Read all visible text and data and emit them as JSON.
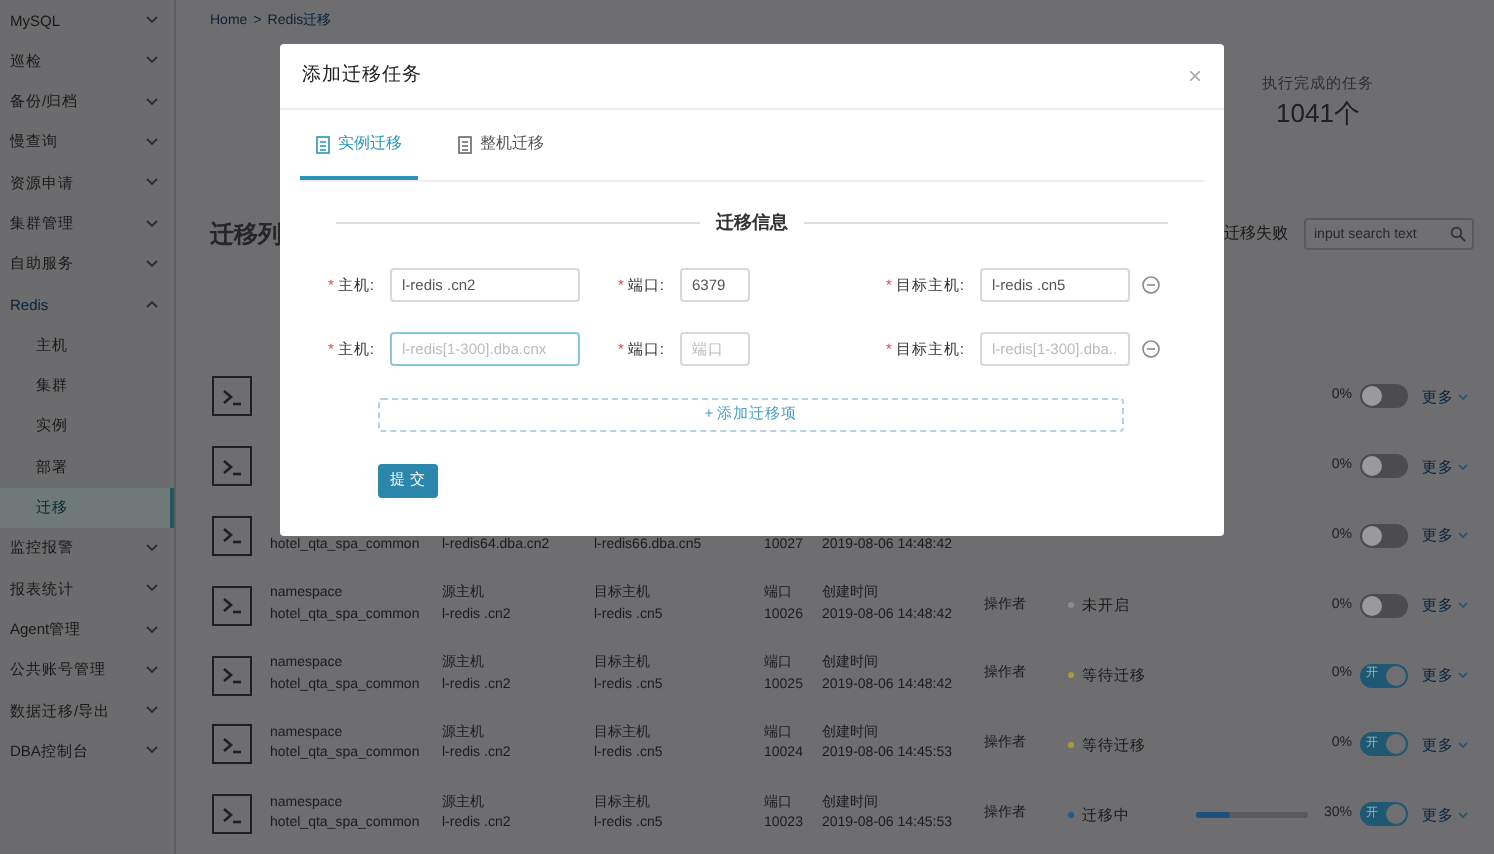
{
  "sidebar": {
    "items": [
      {
        "label": "MySQL",
        "expanded": false
      },
      {
        "label": "巡检",
        "expanded": false
      },
      {
        "label": "备份/归档",
        "expanded": false
      },
      {
        "label": "慢查询",
        "expanded": false
      },
      {
        "label": "资源申请",
        "expanded": false
      },
      {
        "label": "集群管理",
        "expanded": false
      },
      {
        "label": "自助服务",
        "expanded": false
      },
      {
        "label": "Redis",
        "expanded": true,
        "children": [
          {
            "label": "主机",
            "selected": false
          },
          {
            "label": "集群",
            "selected": false
          },
          {
            "label": "实例",
            "selected": false
          },
          {
            "label": "部署",
            "selected": false
          },
          {
            "label": "迁移",
            "selected": true
          }
        ]
      },
      {
        "label": "监控报警",
        "expanded": false
      },
      {
        "label": "报表统计",
        "expanded": false
      },
      {
        "label": "Agent管理",
        "expanded": false
      },
      {
        "label": "公共账号管理",
        "expanded": false
      },
      {
        "label": "数据迁移/导出",
        "expanded": false
      },
      {
        "label": "DBA控制台",
        "expanded": false
      }
    ]
  },
  "breadcrumb": {
    "items": [
      "Home",
      "Redis迁移"
    ],
    "separator": ">"
  },
  "summary": {
    "label": "执行完成的任务",
    "value": "1041个"
  },
  "list": {
    "title": "迁移列",
    "filter_label": "迁移失败",
    "search": {
      "placeholder": "input search text"
    },
    "rows": [
      {
        "percent": "0%",
        "switch_on": false,
        "more": "更多"
      },
      {
        "percent": "0%",
        "switch_on": false,
        "more": "更多"
      },
      {
        "namespace": "hotel_qta_spa_common",
        "source": "l-redis64.dba.cn2",
        "target": "l-redis66.dba.cn5",
        "port": "10027",
        "created": "2019-08-06 14:48:42",
        "percent": "0%",
        "switch_on": false,
        "more": "更多"
      },
      {
        "labels": [
          "namespace",
          "源主机",
          "目标主机",
          "端口",
          "创建时间",
          "操作者"
        ],
        "namespace": "hotel_qta_spa_common",
        "source": "l-redis .cn2",
        "target": "l-redis .cn5",
        "port": "10026",
        "created": "2019-08-06 14:48:42",
        "status": "未开启",
        "color": "#8c8c8c",
        "percent": "0%",
        "switch_on": false,
        "more": "更多"
      },
      {
        "labels": [
          "namespace",
          "源主机",
          "目标主机",
          "端口",
          "创建时间",
          "操作者"
        ],
        "namespace": "hotel_qta_spa_common",
        "source": "l-redis .cn2",
        "target": "l-redis .cn5",
        "port": "10025",
        "created": "2019-08-06 14:48:42",
        "status": "等待迁移",
        "color": "#a89a3c",
        "percent": "0%",
        "switch_on": true,
        "switch_text": "开",
        "more": "更多"
      },
      {
        "labels": [
          "namespace",
          "源主机",
          "目标主机",
          "端口",
          "创建时间",
          "操作者"
        ],
        "namespace": "hotel_qta_spa_common",
        "source": "l-redis .cn2",
        "target": "l-redis .cn5",
        "port": "10024",
        "created": "2019-08-06 14:45:53",
        "status": "等待迁移",
        "color": "#a89a3c",
        "percent": "0%",
        "switch_on": true,
        "switch_text": "开",
        "more": "更多"
      },
      {
        "labels": [
          "namespace",
          "源主机",
          "目标主机",
          "端口",
          "创建时间",
          "操作者"
        ],
        "namespace": "hotel_qta_spa_common",
        "source": "l-redis .cn2",
        "target": "l-redis .cn5",
        "port": "10023",
        "created": "2019-08-06 14:45:53",
        "status": "迁移中",
        "color": "#1f5a8c",
        "level": 0.3,
        "percent": "30%",
        "switch_on": true,
        "switch_text": "开",
        "more": "更多"
      }
    ]
  },
  "modal": {
    "title": "添加迁移任务",
    "close": "×",
    "tabs": [
      {
        "label": "实例迁移",
        "selected": true
      },
      {
        "label": "整机迁移",
        "selected": false
      }
    ],
    "section_title": "迁移信息",
    "form_rows": [
      {
        "fields": [
          {
            "label": "主机:",
            "value": "l-redis .cn2"
          },
          {
            "label": "端口:",
            "value": "6379"
          },
          {
            "label": "目标主机:",
            "value": "l-redis .cn5"
          }
        ]
      },
      {
        "fields": [
          {
            "label": "主机:",
            "placeholder": "l-redis[1-300].dba.cnx"
          },
          {
            "label": "端口:",
            "placeholder": "端口"
          },
          {
            "label": "目标主机:",
            "placeholder": "l-redis[1-300].dba..."
          }
        ]
      }
    ],
    "required_mark": "*",
    "add_button": "+ 添加迁移项",
    "submit_button": "提 交"
  }
}
